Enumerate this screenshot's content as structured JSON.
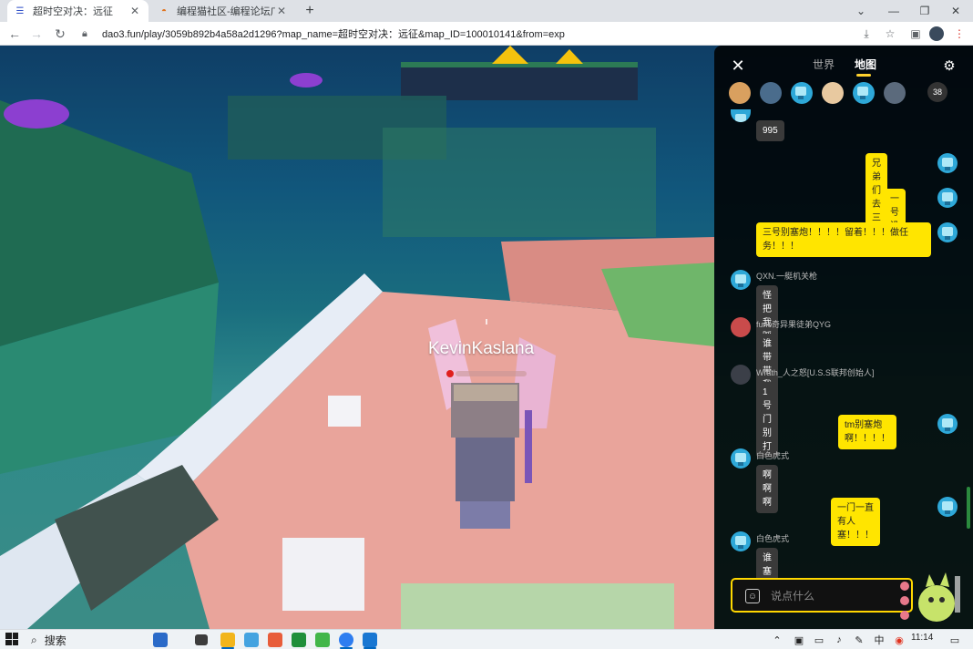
{
  "browser": {
    "tabs": [
      {
        "title": "超时空对决：远征",
        "active": true
      },
      {
        "title": "编程猫社区-编程论坛广场-编",
        "active": false
      }
    ],
    "url": "dao3.fun/play/3059b892b4a58a2d1296?map_name=超时空对决：远征&map_ID=100010141&from=exp"
  },
  "game": {
    "player_name": "KevinKaslana"
  },
  "chat": {
    "tabs": [
      "世界",
      "地图"
    ],
    "active_tab": "地图",
    "online_count": "38",
    "messages": [
      {
        "side": "other",
        "sender": "",
        "text": "995"
      },
      {
        "side": "self",
        "sender": "",
        "text": "兄弟们去三号"
      },
      {
        "side": "self",
        "sender": "",
        "text": "一号没了"
      },
      {
        "side": "self",
        "sender": "",
        "text": "三号别塞炮！！！！留着！！！做任务！！！"
      },
      {
        "side": "other",
        "sender": "QXN.一艇机关枪",
        "text": "怪把我踩死了"
      },
      {
        "side": "other",
        "sender": "func奇异果徒弟QYG",
        "text": "谁带带我"
      },
      {
        "side": "other",
        "sender": "Wrath_人之怒[U.S.S联邦创始人]",
        "text": "1号门别打"
      },
      {
        "side": "self",
        "sender": "",
        "text": "tm别塞炮啊！！！！"
      },
      {
        "side": "other",
        "sender": "白色虎式",
        "text": "啊啊啊"
      },
      {
        "side": "self",
        "sender": "",
        "text": "一门一直有人塞！！！"
      },
      {
        "side": "other",
        "sender": "白色虎式",
        "text": "谁塞的"
      }
    ],
    "input_placeholder": "说点什么"
  },
  "taskbar": {
    "search_label": "搜索",
    "clock": "11:14"
  },
  "colors": {
    "self_bubble": "#ffe500",
    "other_bubble": "#3a3a3a",
    "input_border": "#ffd800",
    "tab_underline": "#ffd22e"
  }
}
